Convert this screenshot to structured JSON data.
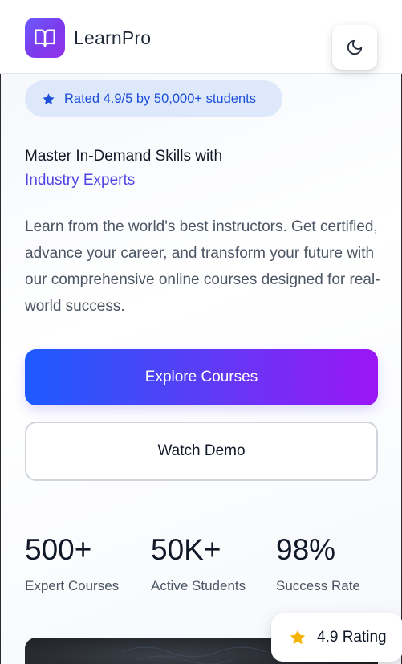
{
  "header": {
    "brand": "LearnPro",
    "logo_icon": "book-open-icon",
    "theme_toggle_icon": "moon-icon"
  },
  "badge": {
    "text": "Rated 4.9/5 by 50,000+ students",
    "icon": "star-icon",
    "color": "#1d4ed8"
  },
  "hero": {
    "headline": "Master In-Demand Skills with",
    "headline_accent": "Industry Experts",
    "description": "Learn from the world's best instructors. Get certified, advance your career, and transform your future with our comprehensive online courses designed for real-world success."
  },
  "actions": {
    "primary_label": "Explore Courses",
    "secondary_label": "Watch Demo"
  },
  "stats": [
    {
      "value": "500+",
      "label": "Expert Courses"
    },
    {
      "value": "50K+",
      "label": "Active Students"
    },
    {
      "value": "98%",
      "label": "Success Rate"
    }
  ],
  "rating_card": {
    "icon": "star-icon",
    "text": "4.9 Rating",
    "star_color": "#f5b301"
  },
  "colors": {
    "brand_gradient_start": "#1d5bff",
    "brand_gradient_end": "#9b16f5",
    "accent": "#4f46e5"
  }
}
